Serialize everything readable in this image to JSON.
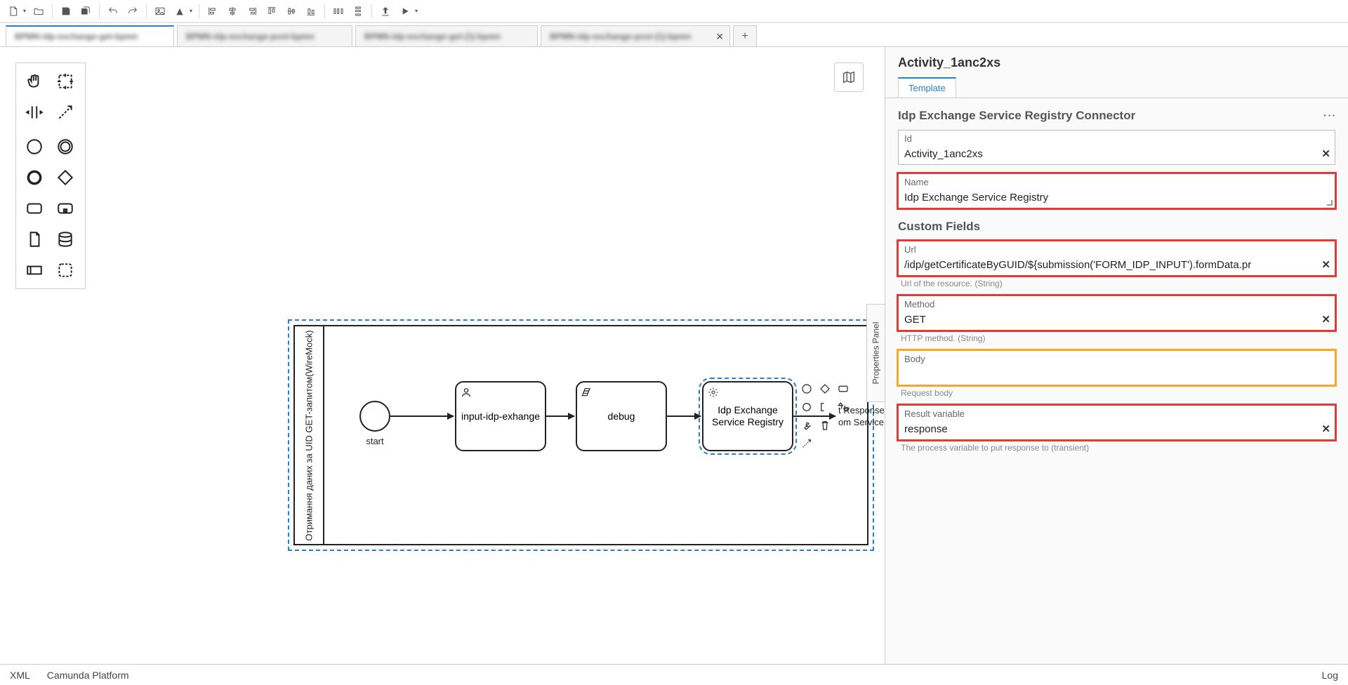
{
  "tabs": {
    "items": [
      {
        "label": "BPMN-idp-exchange-get-bpmn",
        "active": true,
        "closable": false
      },
      {
        "label": "BPMN-idp-exchange-post-bpmn",
        "active": false,
        "closable": false
      },
      {
        "label": "BPMN-idp-exchange-get-(1)-bpmn",
        "active": false,
        "closable": false
      },
      {
        "label": "BPMN-idp-exchange-post-(1)-bpmn",
        "active": false,
        "closable": true
      }
    ],
    "add": "+"
  },
  "canvas": {
    "pool_label": "Отримання даних за UID GET-запитом(WireMock)",
    "start_label": "start",
    "task_input": "input-idp-exhange",
    "task_debug": "debug",
    "task_service": "Idp Exchange Service Registry",
    "end_label_1": "t Response",
    "end_label_2": "om Service",
    "pp_handle": "Properties Panel"
  },
  "props": {
    "header": "Activity_1anc2xs",
    "tab": "Template",
    "group1": "Idp Exchange Service Registry Connector",
    "id_label": "Id",
    "id_value": "Activity_1anc2xs",
    "name_label": "Name",
    "name_value": "Idp Exchange Service Registry",
    "group2": "Custom Fields",
    "url_label": "Url",
    "url_value": "/idp/getCertificateByGUID/${submission('FORM_IDP_INPUT').formData.pr",
    "url_hint": "Url of the resource. (String)",
    "method_label": "Method",
    "method_value": "GET",
    "method_hint": "HTTP method. (String)",
    "body_label": "Body",
    "body_value": "",
    "body_hint": "Request body",
    "result_label": "Result variable",
    "result_value": "response",
    "result_hint": "The process variable to put response to (transient)"
  },
  "status": {
    "xml": "XML",
    "engine": "Camunda Platform",
    "log": "Log"
  }
}
